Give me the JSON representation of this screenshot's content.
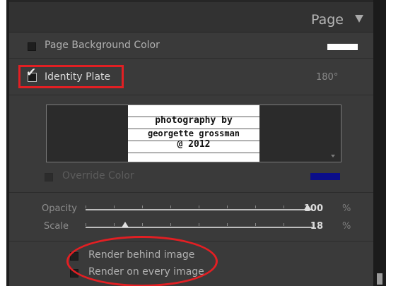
{
  "panel": {
    "title": "Page",
    "collapse_icon": "triangle-down-icon"
  },
  "page_background": {
    "label": "Page Background Color",
    "checked": false,
    "swatch_color": "#ffffff"
  },
  "identity_plate": {
    "label": "Identity Plate",
    "checked": true,
    "rotation": "180°",
    "check_icon": "checkmark-icon",
    "highlight_color": "#e21f23",
    "preview_lines": [
      "photography by",
      "georgette grossman",
      "@ 2012"
    ],
    "dropdown_icon": "triangle-down-icon"
  },
  "override_color": {
    "label": "Override Color",
    "checked": false,
    "swatch_color": "#0b0e8a"
  },
  "sliders": {
    "opacity": {
      "label": "Opacity",
      "value": "100",
      "unit": "%",
      "fraction": 1.0
    },
    "scale": {
      "label": "Scale",
      "value": "18",
      "unit": "%",
      "fraction": 0.18
    }
  },
  "render_options": {
    "behind_image": {
      "label": "Render behind image",
      "checked": false
    },
    "every_image": {
      "label": "Render on every image",
      "checked": false
    },
    "highlight_color": "#e21f23"
  }
}
